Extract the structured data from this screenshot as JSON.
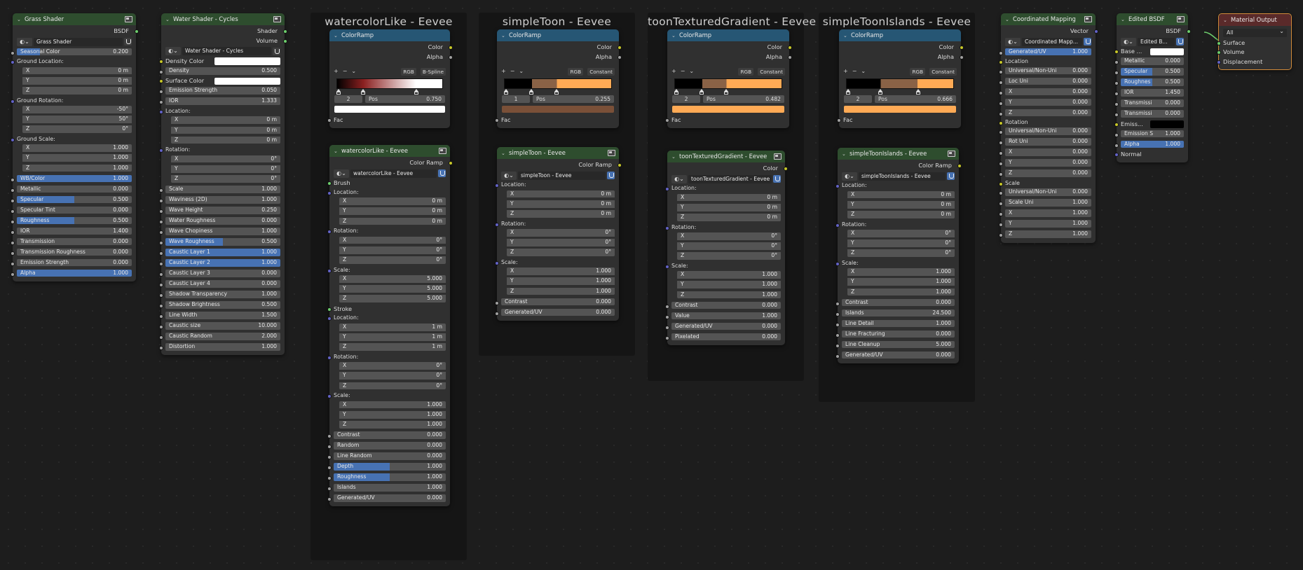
{
  "frames": [
    {
      "title": "watercolorLike - Eevee"
    },
    {
      "title": "simpleToon - Eevee"
    },
    {
      "title": "toonTexturedGradient - Eevee"
    },
    {
      "title": "simpleToonIslands - Eevee"
    }
  ],
  "grass": {
    "title": "Grass Shader",
    "out": "BSDF",
    "datablock": "Grass Shader",
    "seasonal": {
      "label": "Seasonal Color",
      "value": "0.200"
    },
    "loc_label": "Ground Location:",
    "loc": [
      [
        "X",
        "0 m"
      ],
      [
        "Y",
        "0 m"
      ],
      [
        "Z",
        "0 m"
      ]
    ],
    "rot_label": "Ground Rotation:",
    "rot": [
      [
        "X",
        "-50°"
      ],
      [
        "Y",
        "50°"
      ],
      [
        "Z",
        "0°"
      ]
    ],
    "scale_label": "Ground Scale:",
    "scale": [
      [
        "X",
        "1.000"
      ],
      [
        "Y",
        "1.000"
      ],
      [
        "Z",
        "1.000"
      ]
    ],
    "props": [
      {
        "label": "WB/Color",
        "value": "1.000",
        "fill": 1
      },
      {
        "label": "Metallic",
        "value": "0.000",
        "fill": 0
      },
      {
        "label": "Specular",
        "value": "0.500",
        "fill": 0.5
      },
      {
        "label": "Specular Tint",
        "value": "0.000",
        "fill": 0
      },
      {
        "label": "Roughness",
        "value": "0.500",
        "fill": 0.5
      },
      {
        "label": "IOR",
        "value": "1.400",
        "fill": 0
      },
      {
        "label": "Transmission",
        "value": "0.000",
        "fill": 0
      },
      {
        "label": "Transmission Roughness",
        "value": "0.000",
        "fill": 0
      },
      {
        "label": "Emission Strength",
        "value": "0.000",
        "fill": 0
      },
      {
        "label": "Alpha",
        "value": "1.000",
        "fill": 1
      }
    ]
  },
  "water": {
    "title": "Water Shader - Cycles",
    "out1": "Shader",
    "out2": "Volume",
    "datablock": "Water Shader - Cycles",
    "density_color": "Density Color",
    "density": {
      "label": "Density",
      "value": "0.500"
    },
    "surface_color": "Surface Color",
    "emission": {
      "label": "Emission Strength",
      "value": "0.050"
    },
    "ior": {
      "label": "IOR",
      "value": "1.333"
    },
    "loc_label": "Location:",
    "loc": [
      [
        "X",
        "0 m"
      ],
      [
        "Y",
        "0 m"
      ],
      [
        "Z",
        "0 m"
      ]
    ],
    "rot_label": "Rotation:",
    "rot": [
      [
        "X",
        "0°"
      ],
      [
        "Y",
        "0°"
      ],
      [
        "Z",
        "0°"
      ]
    ],
    "props": [
      {
        "label": "Scale",
        "value": "1.000",
        "fill": 0
      },
      {
        "label": "Waviness (2D)",
        "value": "1.000",
        "fill": 0
      },
      {
        "label": "Wave Height",
        "value": "0.250",
        "fill": 0
      },
      {
        "label": "Water Roughness",
        "value": "0.000",
        "fill": 0
      },
      {
        "label": "Wave Chopiness",
        "value": "1.000",
        "fill": 0
      },
      {
        "label": "Wave Roughness",
        "value": "0.500",
        "fill": 0.5
      },
      {
        "label": "Caustic Layer 1",
        "value": "1.000",
        "fill": 1
      },
      {
        "label": "Caustic Layer 2",
        "value": "1.000",
        "fill": 1
      },
      {
        "label": "Caustic Layer 3",
        "value": "0.000",
        "fill": 0
      },
      {
        "label": "Caustic Layer 4",
        "value": "0.000",
        "fill": 0
      },
      {
        "label": "Shadow Transparency",
        "value": "1.000",
        "fill": 0
      },
      {
        "label": "Shadow Brightness",
        "value": "0.500",
        "fill": 0
      },
      {
        "label": "Line Width",
        "value": "1.500",
        "fill": 0
      },
      {
        "label": "Caustic size",
        "value": "10.000",
        "fill": 0
      },
      {
        "label": "Caustic Random",
        "value": "2.000",
        "fill": 0
      },
      {
        "label": "Distortion",
        "value": "1.000",
        "fill": 0
      }
    ]
  },
  "ramps": [
    {
      "title": "ColorRamp",
      "out1": "Color",
      "out2": "Alpha",
      "mode": "RGB",
      "interp": "B-Spline",
      "index": "2",
      "pos_label": "Pos",
      "pos": "0.750",
      "fac": "Fac",
      "swatch": "#ffffff",
      "ramp_colors": [
        "#000000",
        "#8b2020",
        "#ffffff"
      ]
    },
    {
      "title": "ColorRamp",
      "out1": "Color",
      "out2": "Alpha",
      "mode": "RGB",
      "interp": "Constant",
      "index": "1",
      "pos_label": "Pos",
      "pos": "0.255",
      "fac": "Fac",
      "swatch": "#7a5038",
      "ramp_colors": [
        "#000000",
        "#8a6246",
        "#ffaa55"
      ]
    },
    {
      "title": "ColorRamp",
      "out1": "Color",
      "out2": "Alpha",
      "mode": "RGB",
      "interp": "Constant",
      "index": "2",
      "pos_label": "Pos",
      "pos": "0.482",
      "fac": "Fac",
      "swatch": "#ffaa55",
      "ramp_colors": [
        "#000000",
        "#8a6246",
        "#ffaa55"
      ]
    },
    {
      "title": "ColorRamp",
      "out1": "Color",
      "out2": "Alpha",
      "mode": "RGB",
      "interp": "Constant",
      "index": "2",
      "pos_label": "Pos",
      "pos": "0.666",
      "fac": "Fac",
      "swatch": "#ffaa55",
      "ramp_colors": [
        "#000000",
        "#8a6246",
        "#ffaa55"
      ]
    }
  ],
  "groups": {
    "watercolor": {
      "title": "watercolorLike - Eevee",
      "out": "Color Ramp",
      "datablock": "watercolorLike - Eevee",
      "brush": "Brush",
      "loc_label": "Location:",
      "loc": [
        [
          "X",
          "0 m"
        ],
        [
          "Y",
          "0 m"
        ],
        [
          "Z",
          "0 m"
        ]
      ],
      "rot_label": "Rotation:",
      "rot": [
        [
          "X",
          "0°"
        ],
        [
          "Y",
          "0°"
        ],
        [
          "Z",
          "0°"
        ]
      ],
      "scale_label": "Scale:",
      "scale": [
        [
          "X",
          "5.000"
        ],
        [
          "Y",
          "5.000"
        ],
        [
          "Z",
          "5.000"
        ]
      ],
      "stroke": "Stroke",
      "loc2": [
        [
          "X",
          "1 m"
        ],
        [
          "Y",
          "1 m"
        ],
        [
          "Z",
          "1 m"
        ]
      ],
      "rot2": [
        [
          "X",
          "0°"
        ],
        [
          "Y",
          "0°"
        ],
        [
          "Z",
          "0°"
        ]
      ],
      "scale2": [
        [
          "X",
          "1.000"
        ],
        [
          "Y",
          "1.000"
        ],
        [
          "Z",
          "1.000"
        ]
      ],
      "props": [
        {
          "label": "Contrast",
          "value": "0.000",
          "fill": 0
        },
        {
          "label": "Random",
          "value": "0.000",
          "fill": 0
        },
        {
          "label": "Line Random",
          "value": "0.000",
          "fill": 0
        },
        {
          "label": "Depth",
          "value": "1.000",
          "fill": 1
        },
        {
          "label": "Roughness",
          "value": "1.000",
          "fill": 1
        },
        {
          "label": "Islands",
          "value": "1.000",
          "fill": 0
        },
        {
          "label": "Generated/UV",
          "value": "0.000",
          "fill": 0
        }
      ]
    },
    "toon": {
      "title": "simpleToon - Eevee",
      "out": "Color Ramp",
      "datablock": "simpleToon - Eevee",
      "loc_label": "Location:",
      "loc": [
        [
          "X",
          "0 m"
        ],
        [
          "Y",
          "0 m"
        ],
        [
          "Z",
          "0 m"
        ]
      ],
      "rot_label": "Rotation:",
      "rot": [
        [
          "X",
          "0°"
        ],
        [
          "Y",
          "0°"
        ],
        [
          "Z",
          "0°"
        ]
      ],
      "scale_label": "Scale:",
      "scale": [
        [
          "X",
          "1.000"
        ],
        [
          "Y",
          "1.000"
        ],
        [
          "Z",
          "1.000"
        ]
      ],
      "props": [
        {
          "label": "Contrast",
          "value": "0.000"
        },
        {
          "label": "Generated/UV",
          "value": "0.000"
        }
      ]
    },
    "gradient": {
      "title": "toonTexturedGradient - Eevee",
      "out": "Color",
      "datablock": "toonTexturedGradient - Eevee",
      "loc_label": "Location:",
      "loc": [
        [
          "X",
          "0 m"
        ],
        [
          "Y",
          "0 m"
        ],
        [
          "Z",
          "0 m"
        ]
      ],
      "rot_label": "Rotation:",
      "rot": [
        [
          "X",
          "0°"
        ],
        [
          "Y",
          "0°"
        ],
        [
          "Z",
          "0°"
        ]
      ],
      "scale_label": "Scale:",
      "scale": [
        [
          "X",
          "1.000"
        ],
        [
          "Y",
          "1.000"
        ],
        [
          "Z",
          "1.000"
        ]
      ],
      "props": [
        {
          "label": "Contrast",
          "value": "0.000"
        },
        {
          "label": "Value",
          "value": "1.000"
        },
        {
          "label": "Generated/UV",
          "value": "0.000"
        },
        {
          "label": "Pixelated",
          "value": "0.000"
        }
      ]
    },
    "islands": {
      "title": "simpleToonIslands - Eevee",
      "out": "Color Ramp",
      "datablock": "simpleToonIslands - Eevee",
      "loc_label": "Location:",
      "loc": [
        [
          "X",
          "0 m"
        ],
        [
          "Y",
          "0 m"
        ],
        [
          "Z",
          "0 m"
        ]
      ],
      "rot_label": "Rotation:",
      "rot": [
        [
          "X",
          "0°"
        ],
        [
          "Y",
          "0°"
        ],
        [
          "Z",
          "0°"
        ]
      ],
      "scale_label": "Scale:",
      "scale": [
        [
          "X",
          "1.000"
        ],
        [
          "Y",
          "1.000"
        ],
        [
          "Z",
          "1.000"
        ]
      ],
      "props": [
        {
          "label": "Contrast",
          "value": "0.000"
        },
        {
          "label": "Islands",
          "value": "24.500"
        },
        {
          "label": "Line Detail",
          "value": "1.000"
        },
        {
          "label": "Line Fracturing",
          "value": "0.000"
        },
        {
          "label": "Line Cleanup",
          "value": "5.000"
        },
        {
          "label": "Generated/UV",
          "value": "0.000"
        }
      ]
    }
  },
  "mapping": {
    "title": "Coordinated Mapping",
    "out": "Vector",
    "datablock": "Coordinated Mapp...",
    "gen": {
      "label": "Generated/UV",
      "value": "1.000"
    },
    "loc_label": "Location",
    "loc": [
      [
        "Universal/Non-Uni",
        "0.000"
      ],
      [
        "Loc Uni",
        "0.000"
      ],
      [
        "X",
        "0.000"
      ],
      [
        "Y",
        "0.000"
      ],
      [
        "Z",
        "0.000"
      ]
    ],
    "rot_label": "Rotation",
    "rot": [
      [
        "Universal/Non-Uni",
        "0.000"
      ],
      [
        "Rot Uni",
        "0.000"
      ],
      [
        "X",
        "0.000"
      ],
      [
        "Y",
        "0.000"
      ],
      [
        "Z",
        "0.000"
      ]
    ],
    "scale_label": "Scale",
    "scale": [
      [
        "Universal/Non-Uni",
        "0.000"
      ],
      [
        "Scale Uni",
        "1.000"
      ],
      [
        "X",
        "1.000"
      ],
      [
        "Y",
        "1.000"
      ],
      [
        "Z",
        "1.000"
      ]
    ]
  },
  "edited": {
    "title": "Edited BSDF",
    "out": "BSDF",
    "datablock": "Edited B...",
    "base": "Base ...",
    "props": [
      {
        "label": "Metallic",
        "value": "0.000",
        "fill": 0
      },
      {
        "label": "Specular",
        "value": "0.500",
        "fill": 0.5
      },
      {
        "label": "Roughnes",
        "value": "0.500",
        "fill": 0.5
      },
      {
        "label": "IOR",
        "value": "1.450",
        "fill": 0
      },
      {
        "label": "Transmissi",
        "value": "0.000",
        "fill": 0
      },
      {
        "label": "Transmissi",
        "value": "0.000",
        "fill": 0
      }
    ],
    "emiss": "Emiss...",
    "props2": [
      {
        "label": "Emission S",
        "value": "1.000",
        "fill": 0
      },
      {
        "label": "Alpha",
        "value": "1.000",
        "fill": 1
      }
    ],
    "normal": "Normal"
  },
  "output": {
    "title": "Material Output",
    "target": "All",
    "inputs": [
      "Surface",
      "Volume",
      "Displacement"
    ]
  },
  "colors": {
    "accent": "#4772b3",
    "group_header": "#2e4d2e",
    "ramp_header": "#265674",
    "output_header": "#5a2a2a"
  }
}
